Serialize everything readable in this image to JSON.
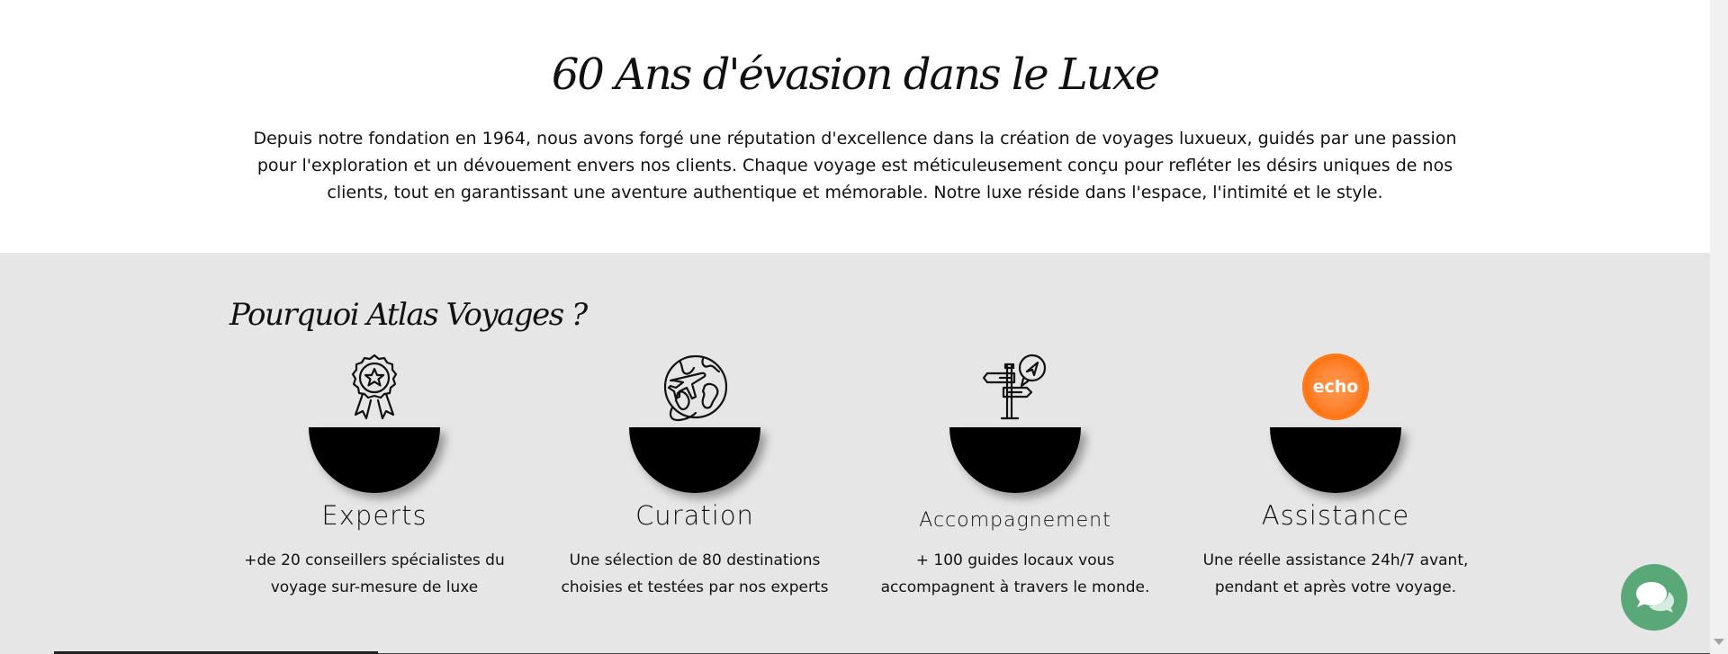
{
  "intro": {
    "title": "60 Ans d'évasion dans le Luxe",
    "text": "Depuis notre fondation en 1964, nous avons forgé une réputation d'excellence dans la création de voyages luxueux, guidés par une passion pour l'exploration et un dévouement envers nos clients. Chaque voyage est méticuleusement conçu pour refléter les désirs uniques de nos clients, tout en garantissant une aventure authentique et mémorable. Notre luxe réside dans l'espace, l'intimité et le style."
  },
  "why": {
    "title": "Pourquoi Atlas Voyages ?",
    "features": [
      {
        "title": "Experts",
        "desc": "+de 20 conseillers spécialistes du voyage sur-mesure de luxe",
        "icon": "award-medal-icon"
      },
      {
        "title": "Curation",
        "desc": "Une sélection de 80 destinations choisies et testées par nos experts",
        "icon": "globe-plane-icon"
      },
      {
        "title": "Accompagnement",
        "desc": "+ 100 guides locaux vous accompagnent à travers le monde.",
        "icon": "signpost-location-icon"
      },
      {
        "title": "Assistance",
        "desc": "Une réelle assistance 24h/7 avant, pendant et après votre voyage.",
        "icon": "echo-badge-icon",
        "badge_text": "echo"
      }
    ]
  },
  "chat": {
    "icon": "chat-bubbles-icon"
  },
  "colors": {
    "section_bg": "#e6e6e6",
    "chat_green": "#5aa878",
    "echo_orange": "#ff7a1a"
  }
}
